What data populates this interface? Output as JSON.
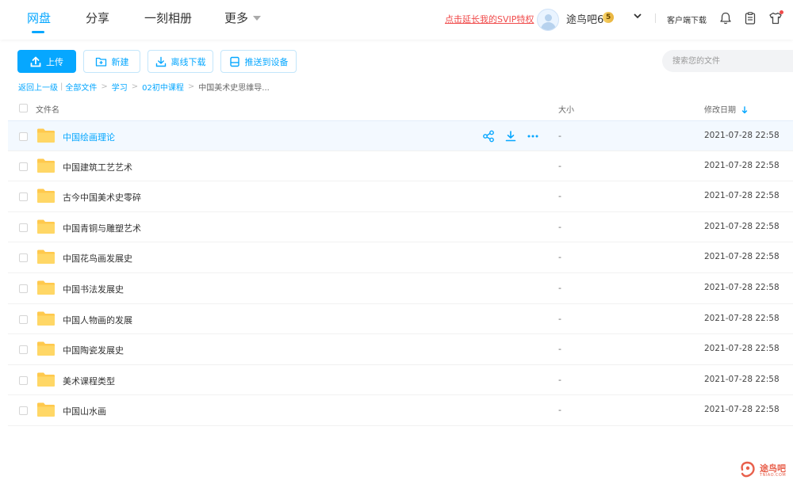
{
  "nav": {
    "tabs": [
      {
        "label": "网盘",
        "active": true
      },
      {
        "label": "分享",
        "active": false
      },
      {
        "label": "一刻相册",
        "active": false
      },
      {
        "label": "更多",
        "active": false
      }
    ],
    "svip_link": "点击延长我的SVIP特权",
    "username": "途鸟吧6",
    "svip_level": "5",
    "client_download": "客户端下载",
    "icons": [
      "bell-icon",
      "clipboard-icon",
      "shirt-icon"
    ],
    "accent_color": "#06a7ff"
  },
  "toolbar": {
    "upload": "上传",
    "new": "新建",
    "offline_download": "离线下载",
    "push_to_device": "推送到设备",
    "search_placeholder": "搜索您的文件"
  },
  "breadcrumb": {
    "back": "返回上一级",
    "items": [
      "全部文件",
      "学习",
      "02初中课程"
    ],
    "current": "中国美术史思维导..."
  },
  "table": {
    "headers": {
      "name": "文件名",
      "size": "大小",
      "date": "修改日期"
    },
    "rows": [
      {
        "name": "中国绘画理论",
        "size": "-",
        "date": "2021-07-28 22:58"
      },
      {
        "name": "中国建筑工艺艺术",
        "size": "-",
        "date": "2021-07-28 22:58"
      },
      {
        "name": "古今中国美术史零碎",
        "size": "-",
        "date": "2021-07-28 22:58"
      },
      {
        "name": "中国青铜与雕塑艺术",
        "size": "-",
        "date": "2021-07-28 22:58"
      },
      {
        "name": "中国花鸟画发展史",
        "size": "-",
        "date": "2021-07-28 22:58"
      },
      {
        "name": "中国书法发展史",
        "size": "-",
        "date": "2021-07-28 22:58"
      },
      {
        "name": "中国人物画的发展",
        "size": "-",
        "date": "2021-07-28 22:58"
      },
      {
        "name": "中国陶瓷发展史",
        "size": "-",
        "date": "2021-07-28 22:58"
      },
      {
        "name": "美术课程类型",
        "size": "-",
        "date": "2021-07-28 22:58"
      },
      {
        "name": "中国山水画",
        "size": "-",
        "date": "2021-07-28 22:58"
      }
    ]
  },
  "watermark": {
    "text": "途鸟吧",
    "sub": "TNIAO.COM"
  }
}
